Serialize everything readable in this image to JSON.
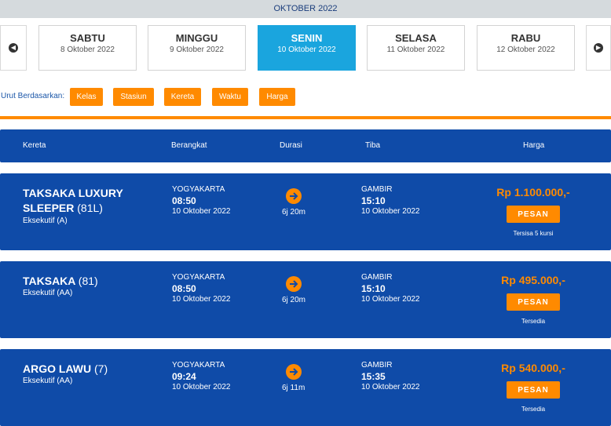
{
  "month": "OKTOBER 2022",
  "days": [
    {
      "name": "SABTU",
      "date": "8 Oktober 2022"
    },
    {
      "name": "MINGGU",
      "date": "9 Oktober 2022"
    },
    {
      "name": "SENIN",
      "date": "10 Oktober 2022"
    },
    {
      "name": "SELASA",
      "date": "11 Oktober 2022"
    },
    {
      "name": "RABU",
      "date": "12 Oktober 2022"
    }
  ],
  "active_day": "SENIN",
  "sort": {
    "label": "Urut Berdasarkan:",
    "options": [
      "Kelas",
      "Stasiun",
      "Kereta",
      "Waktu",
      "Harga"
    ]
  },
  "table_header": {
    "train": "Kereta",
    "depart": "Berangkat",
    "duration": "Durasi",
    "arrive": "Tiba",
    "price": "Harga"
  },
  "trains": [
    {
      "name": "TAKSAKA LUXURY SLEEPER",
      "number": "(81L)",
      "class": "Eksekutif (A)",
      "depart_station": "YOGYAKARTA",
      "depart_time": "08:50",
      "depart_date": "10 Oktober 2022",
      "duration": "6j 20m",
      "arrive_station": "GAMBIR",
      "arrive_time": "15:10",
      "arrive_date": "10 Oktober 2022",
      "price": "Rp 1.100.000,-",
      "button": "PESAN",
      "availability": "Tersisa 5 kursi"
    },
    {
      "name": "TAKSAKA",
      "number": "(81)",
      "class": "Eksekutif (AA)",
      "depart_station": "YOGYAKARTA",
      "depart_time": "08:50",
      "depart_date": "10 Oktober 2022",
      "duration": "6j 20m",
      "arrive_station": "GAMBIR",
      "arrive_time": "15:10",
      "arrive_date": "10 Oktober 2022",
      "price": "Rp 495.000,-",
      "button": "PESAN",
      "availability": "Tersedia"
    },
    {
      "name": "ARGO LAWU",
      "number": "(7)",
      "class": "Eksekutif (AA)",
      "depart_station": "YOGYAKARTA",
      "depart_time": "09:24",
      "depart_date": "10 Oktober 2022",
      "duration": "6j 11m",
      "arrive_station": "GAMBIR",
      "arrive_time": "15:35",
      "arrive_date": "10 Oktober 2022",
      "price": "Rp 540.000,-",
      "button": "PESAN",
      "availability": "Tersedia"
    }
  ],
  "icons": {
    "prev": "arrow-left-icon",
    "next": "arrow-right-icon",
    "duration": "arrow-right-circle-icon"
  },
  "colors": {
    "primary": "#0f4ba8",
    "accent": "#ff8a00",
    "active_day": "#1aa5de"
  }
}
